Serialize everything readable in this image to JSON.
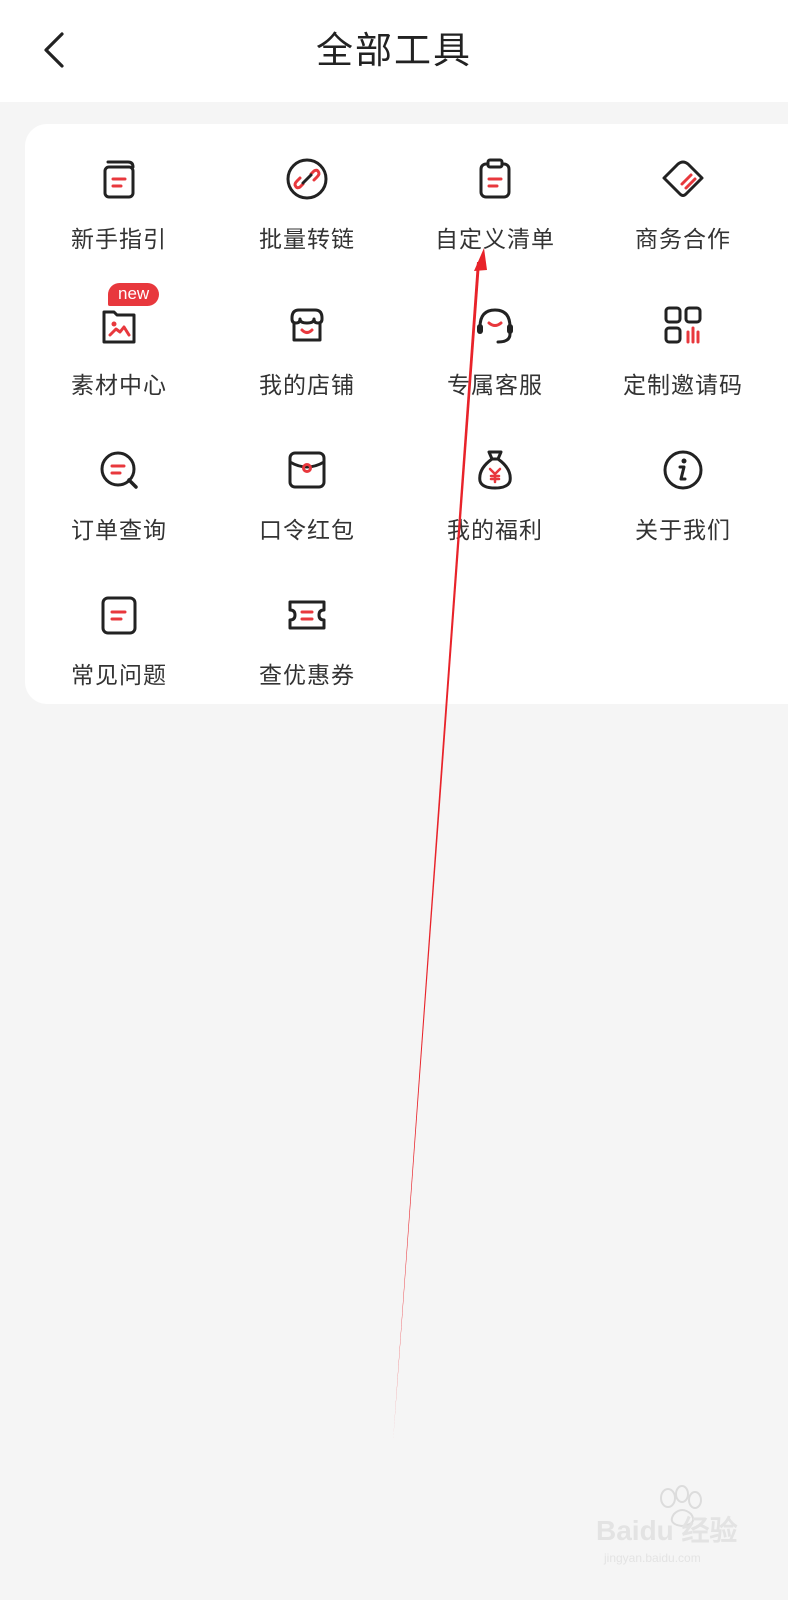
{
  "header": {
    "title": "全部工具"
  },
  "tools": [
    {
      "label": "新手指引",
      "icon": "guide-doc-icon"
    },
    {
      "label": "批量转链",
      "icon": "link-icon"
    },
    {
      "label": "自定义清单",
      "icon": "clipboard-icon"
    },
    {
      "label": "商务合作",
      "icon": "handshake-icon"
    },
    {
      "label": "素材中心",
      "icon": "image-folder-icon",
      "badge": "new"
    },
    {
      "label": "我的店铺",
      "icon": "store-icon"
    },
    {
      "label": "专属客服",
      "icon": "headset-icon"
    },
    {
      "label": "定制邀请码",
      "icon": "qrcode-grid-icon"
    },
    {
      "label": "订单查询",
      "icon": "search-chat-icon"
    },
    {
      "label": "口令红包",
      "icon": "red-envelope-icon"
    },
    {
      "label": "我的福利",
      "icon": "money-bag-icon"
    },
    {
      "label": "关于我们",
      "icon": "info-icon"
    },
    {
      "label": "常见问题",
      "icon": "faq-doc-icon"
    },
    {
      "label": "查优惠券",
      "icon": "coupon-icon"
    }
  ],
  "watermark": {
    "text": "Baidu 经验",
    "subtext": "jingyan.baidu.com"
  },
  "colors": {
    "accent": "#e8383d",
    "icon_stroke": "#222222",
    "text": "#333333",
    "background": "#f5f5f5"
  }
}
